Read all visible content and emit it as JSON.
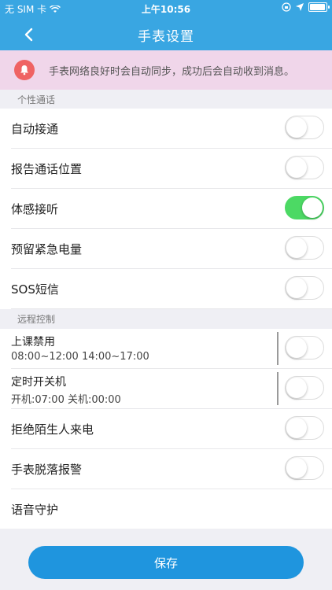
{
  "status_bar": {
    "carrier": "无 SIM 卡",
    "time": "上午10:56",
    "battery_level": 0.95
  },
  "nav": {
    "title": "手表设置",
    "back_icon": "chevron-left-icon"
  },
  "notice": {
    "icon": "bell-icon",
    "text": "手表网络良好时会自动同步，成功后会自动收到消息。"
  },
  "sections": {
    "personal_call": {
      "title": "个性通话"
    },
    "remote_control": {
      "title": "远程控制"
    }
  },
  "personal_call_rows": [
    {
      "label": "自动接通",
      "on": false
    },
    {
      "label": "报告通话位置",
      "on": false
    },
    {
      "label": "体感接听",
      "on": true
    },
    {
      "label": "预留紧急电量",
      "on": false
    },
    {
      "label": "SOS短信",
      "on": false
    }
  ],
  "remote_rows": [
    {
      "label": "上课禁用",
      "sub": "08:00~12:00 14:00~17:00",
      "on": false
    },
    {
      "label": "定时开关机",
      "sub": "开机:07:00 关机:00:00",
      "on": false
    },
    {
      "label": "拒绝陌生人来电",
      "on": false
    },
    {
      "label": "手表脱落报警",
      "on": false
    },
    {
      "label": "语音守护"
    }
  ],
  "save_button": {
    "label": "保存"
  },
  "colors": {
    "header": "#39a6e2",
    "toggle_on": "#4cd964",
    "save": "#1f95de",
    "notice_bg": "#f0d6ea",
    "notice_icon": "#ef6363"
  }
}
